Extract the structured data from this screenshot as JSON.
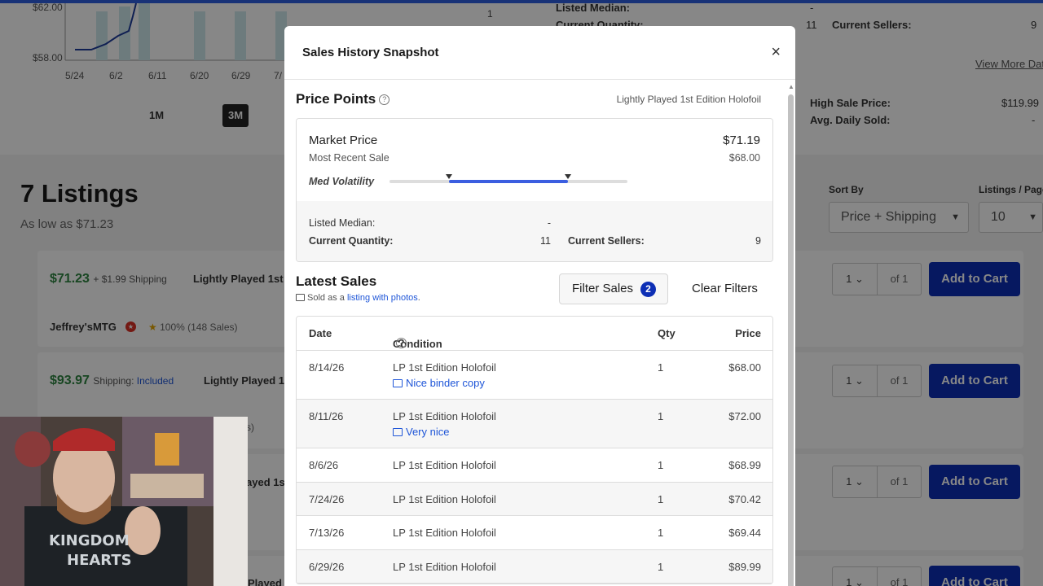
{
  "background": {
    "chart": {
      "y_ticks": [
        "$62.00",
        "$58.00"
      ],
      "x_ticks": [
        "5/24",
        "6/2",
        "6/11",
        "6/20",
        "6/29",
        "7/"
      ],
      "ranges": [
        "1M",
        "3M"
      ],
      "active_range": "3M",
      "right_number": "1"
    },
    "right_panel": {
      "listed_median_label": "Listed Median:",
      "listed_median_value": "-",
      "current_quantity_label": "Current Quantity:",
      "current_quantity_value": "11",
      "current_sellers_label": "Current Sellers:",
      "current_sellers_value": "9",
      "view_more": "View More Dat",
      "high_sale_label": "High Sale Price:",
      "high_sale_value": "$119.99",
      "avg_daily_label": "Avg. Daily Sold:",
      "avg_daily_value": "-"
    },
    "listings_title": "7 Listings",
    "listings_subtitle": "As low as $71.23",
    "sort_by_label": "Sort By",
    "sort_by_value": "Price + Shipping",
    "per_page_label": "Listings / Page",
    "per_page_value": "10",
    "listings": [
      {
        "price": "$71.23",
        "shipping": "+ $1.99 Shipping",
        "shipping_included": "",
        "condition": "Lightly Played 1st E",
        "seller": "Jeffrey'sMTG",
        "rating": "100% (148 Sales)",
        "qty": "1",
        "of": "of 1",
        "cart": "Add to Cart"
      },
      {
        "price": "$93.97",
        "shipping": "Shipping:",
        "shipping_included": "Included",
        "condition": "Lightly Played 1s",
        "seller": "",
        "rating": "",
        "qty": "1",
        "of": "of 1",
        "cart": "Add to Cart"
      },
      {
        "price": "",
        "shipping": "",
        "shipping_included": "",
        "condition": "ayed 1s",
        "seller": "",
        "rating": "",
        "qty": "1",
        "of": "of 1",
        "cart": "Add to Cart"
      },
      {
        "price": "",
        "shipping": "",
        "shipping_included": "",
        "condition": "Played",
        "seller": "",
        "rating": "",
        "qty": "1",
        "of": "of 1",
        "cart": "Add to Cart"
      }
    ],
    "partial_text": "s)"
  },
  "modal": {
    "title": "Sales History Snapshot",
    "close_glyph": "×",
    "price_points": {
      "title": "Price Points",
      "variant": "Lightly Played 1st Edition Holofoil",
      "market_price_label": "Market Price",
      "market_price_value": "$71.19",
      "most_recent_label": "Most Recent Sale",
      "most_recent_value": "$68.00",
      "volatility_label": "Med Volatility",
      "volatility_range": [
        0.25,
        0.75
      ],
      "listed_median_label": "Listed Median:",
      "listed_median_value": "-",
      "current_quantity_label": "Current Quantity:",
      "current_quantity_value": "11",
      "current_sellers_label": "Current Sellers:",
      "current_sellers_value": "9"
    },
    "latest_sales": {
      "title": "Latest Sales",
      "subtitle_prefix": "Sold as a",
      "subtitle_link": "listing with photos",
      "subtitle_suffix": ".",
      "filter_label": "Filter Sales",
      "filter_count": "2",
      "clear_label": "Clear Filters",
      "columns": {
        "date": "Date",
        "condition": "Condition",
        "qty": "Qty",
        "price": "Price"
      },
      "rows": [
        {
          "date": "8/14/26",
          "condition": "LP 1st Edition Holofoil",
          "note": "Nice binder copy",
          "qty": "1",
          "price": "$68.00"
        },
        {
          "date": "8/11/26",
          "condition": "LP 1st Edition Holofoil",
          "note": "Very nice",
          "qty": "1",
          "price": "$72.00"
        },
        {
          "date": "8/6/26",
          "condition": "LP 1st Edition Holofoil",
          "note": "",
          "qty": "1",
          "price": "$68.99"
        },
        {
          "date": "7/24/26",
          "condition": "LP 1st Edition Holofoil",
          "note": "",
          "qty": "1",
          "price": "$70.42"
        },
        {
          "date": "7/13/26",
          "condition": "LP 1st Edition Holofoil",
          "note": "",
          "qty": "1",
          "price": "$69.44"
        },
        {
          "date": "6/29/26",
          "condition": "LP 1st Edition Holofoil",
          "note": "",
          "qty": "1",
          "price": "$89.99"
        }
      ]
    }
  }
}
